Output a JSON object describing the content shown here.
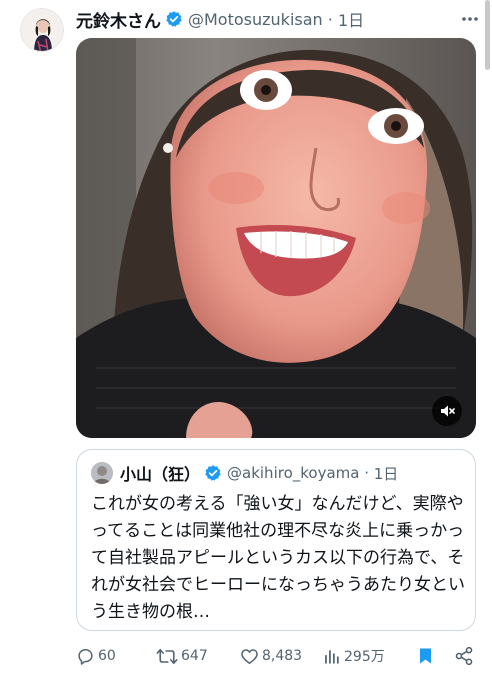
{
  "tweet": {
    "display_name": "元鈴木さん",
    "handle": "@Motosuzukisan",
    "time": "1日",
    "more_icon": "more-dots-icon"
  },
  "media": {
    "type": "video",
    "mute_icon": "volume-muted-icon"
  },
  "quote": {
    "display_name": "小山（狂）",
    "handle": "@akihiro_koyama",
    "time": "1日",
    "text": "これが女の考える「強い女」なんだけど、実際やってることは同業他社の理不尽な炎上に乗っかって自社製品アピールというカス以下の行為で、それが女社会でヒーローになっちゃうあたり女という生き物の根…"
  },
  "actions": {
    "replies": "60",
    "reposts": "647",
    "likes": "8,483",
    "views": "295万"
  },
  "colors": {
    "verified": "#1d9bf0",
    "secondary_text": "#536471",
    "bookmark_active": "#1d9bf0",
    "border": "#cfd9de"
  }
}
